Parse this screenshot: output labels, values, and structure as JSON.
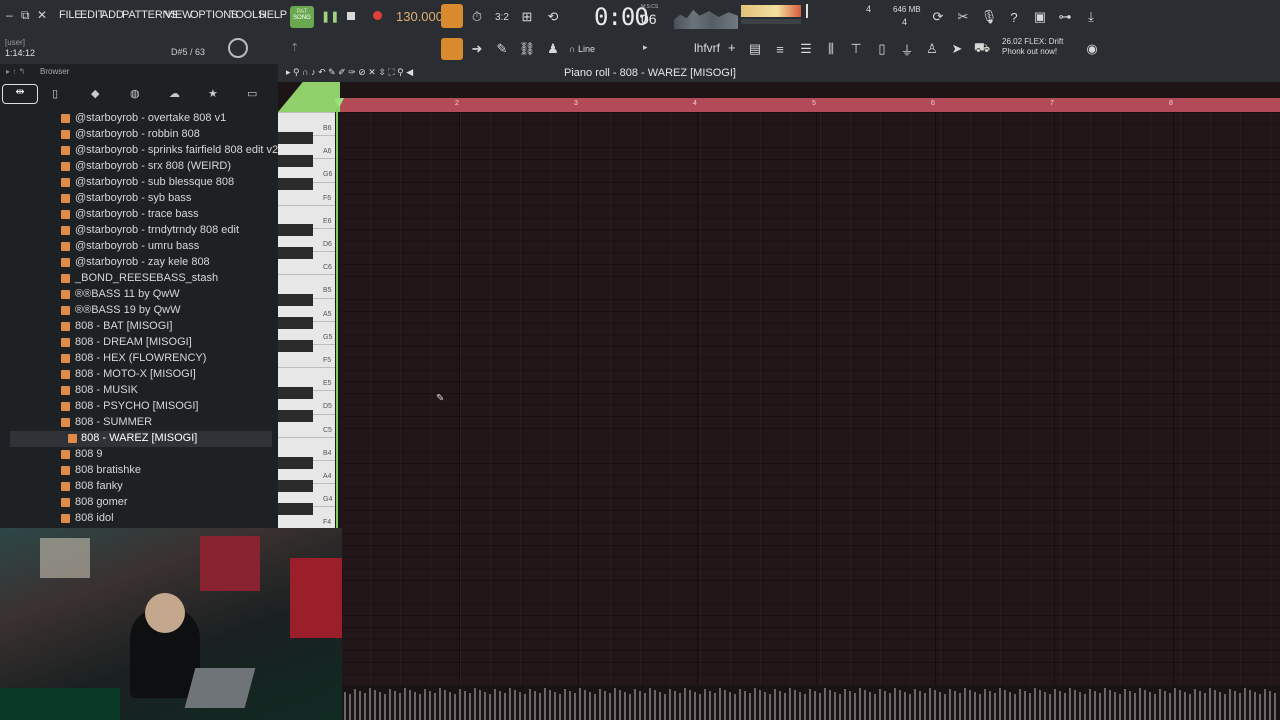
{
  "menu": {
    "file": "FILE",
    "edit": "EDIT",
    "add": "ADD",
    "patterns": "PATTERNS",
    "view": "VIEW",
    "options": "OPTIONS",
    "tools": "TOOLS",
    "help": "HELP"
  },
  "transport": {
    "pat_song": "SONG",
    "pat_label": "PAT",
    "tempo": "130.000",
    "time": "0:00",
    "time_small": "06",
    "time_label": "M:S:CS",
    "mem": "646 MB",
    "cpu_top": "4",
    "cpu_bottom": "4"
  },
  "hint": {
    "line1": "26.02  FLEX: Drift",
    "line2": "Phonk out now!"
  },
  "status": {
    "user": "[user]",
    "time": "1:14:12",
    "note": "D#5 / 63"
  },
  "toolbar2": {
    "snap": "Line",
    "pattern": "lhfvrf"
  },
  "browser": {
    "title": "Browser",
    "items": [
      "@starboyrob - overtake 808 v1",
      "@starboyrob - robbin 808",
      "@starboyrob - sprinks fairfield 808 edit v2",
      "@starboyrob - srx 808 (WEIRD)",
      "@starboyrob - sub blessque 808",
      "@starboyrob - syb bass",
      "@starboyrob - trace bass",
      "@starboyrob - trndytrndy 808 edit",
      "@starboyrob - umru bass",
      "@starboyrob - zay kele 808",
      "_BOND_REESEBASS_stash",
      "®®BASS 11 by QwW",
      "®®BASS 19 by QwW",
      "808 - BAT [MISOGI]",
      "808 - DREAM [MISOGI]",
      "808 - HEX (FLOWRENCY)",
      "808 - MOTO-X [MISOGI]",
      "808 - MUSIK",
      "808 - PSYCHO [MISOGI]",
      "808 - SUMMER",
      "808 - WAREZ [MISOGI]",
      "808 9",
      "808 bratishke",
      "808 fanky",
      "808 gomer",
      "808 idol"
    ]
  },
  "pianoroll": {
    "title": "Piano roll - 808 - WAREZ [MISOGI]",
    "bars": [
      "2",
      "3",
      "4",
      "5",
      "6",
      "7",
      "8"
    ],
    "keys": [
      "B6",
      "A6",
      "G6",
      "F6",
      "E6",
      "D6",
      "C6",
      "B5",
      "A5",
      "G5",
      "F5",
      "E5",
      "D5",
      "C5",
      "B4",
      "A4",
      "G4",
      "F4"
    ]
  }
}
